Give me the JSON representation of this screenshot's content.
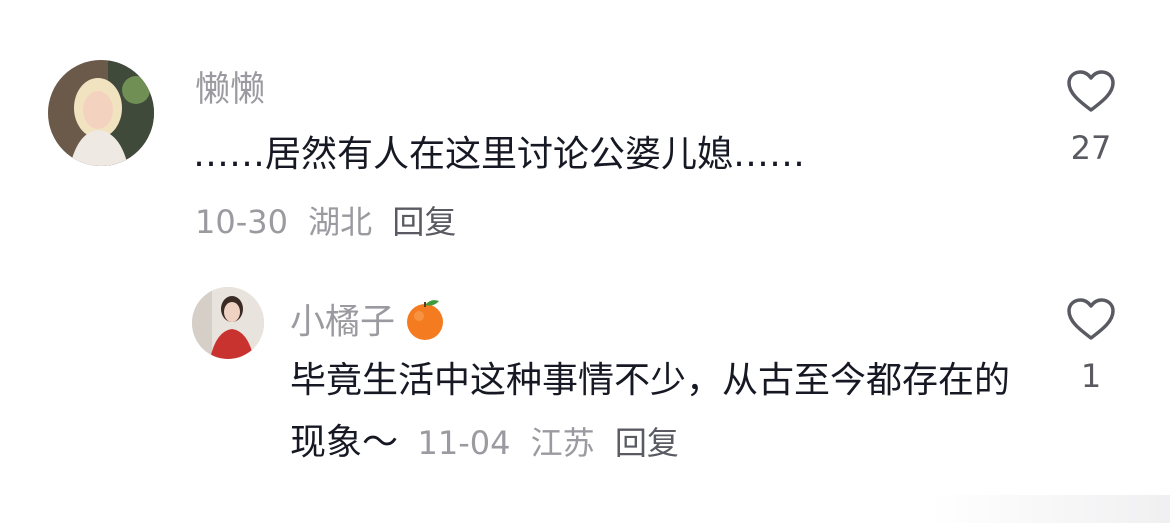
{
  "comments": [
    {
      "username": "懒懒",
      "text": "……居然有人在这里讨论公婆儿媳……",
      "date": "10-30",
      "location": "湖北",
      "reply_label": "回复",
      "likes": "27",
      "avatar_icon": "user-avatar-photo"
    },
    {
      "username": "小橘子",
      "username_emoji": "tangerine-emoji",
      "text": "毕竟生活中这种事情不少，从古至今都存在的现象～",
      "date": "11-04",
      "location": "江苏",
      "reply_label": "回复",
      "likes": "1",
      "avatar_icon": "user-avatar-photo"
    }
  ],
  "colors": {
    "username": "#9a9aa0",
    "text": "#161823",
    "meta": "#9a9aa0",
    "icon": "#5a5b62",
    "orange": "#f47b20"
  }
}
